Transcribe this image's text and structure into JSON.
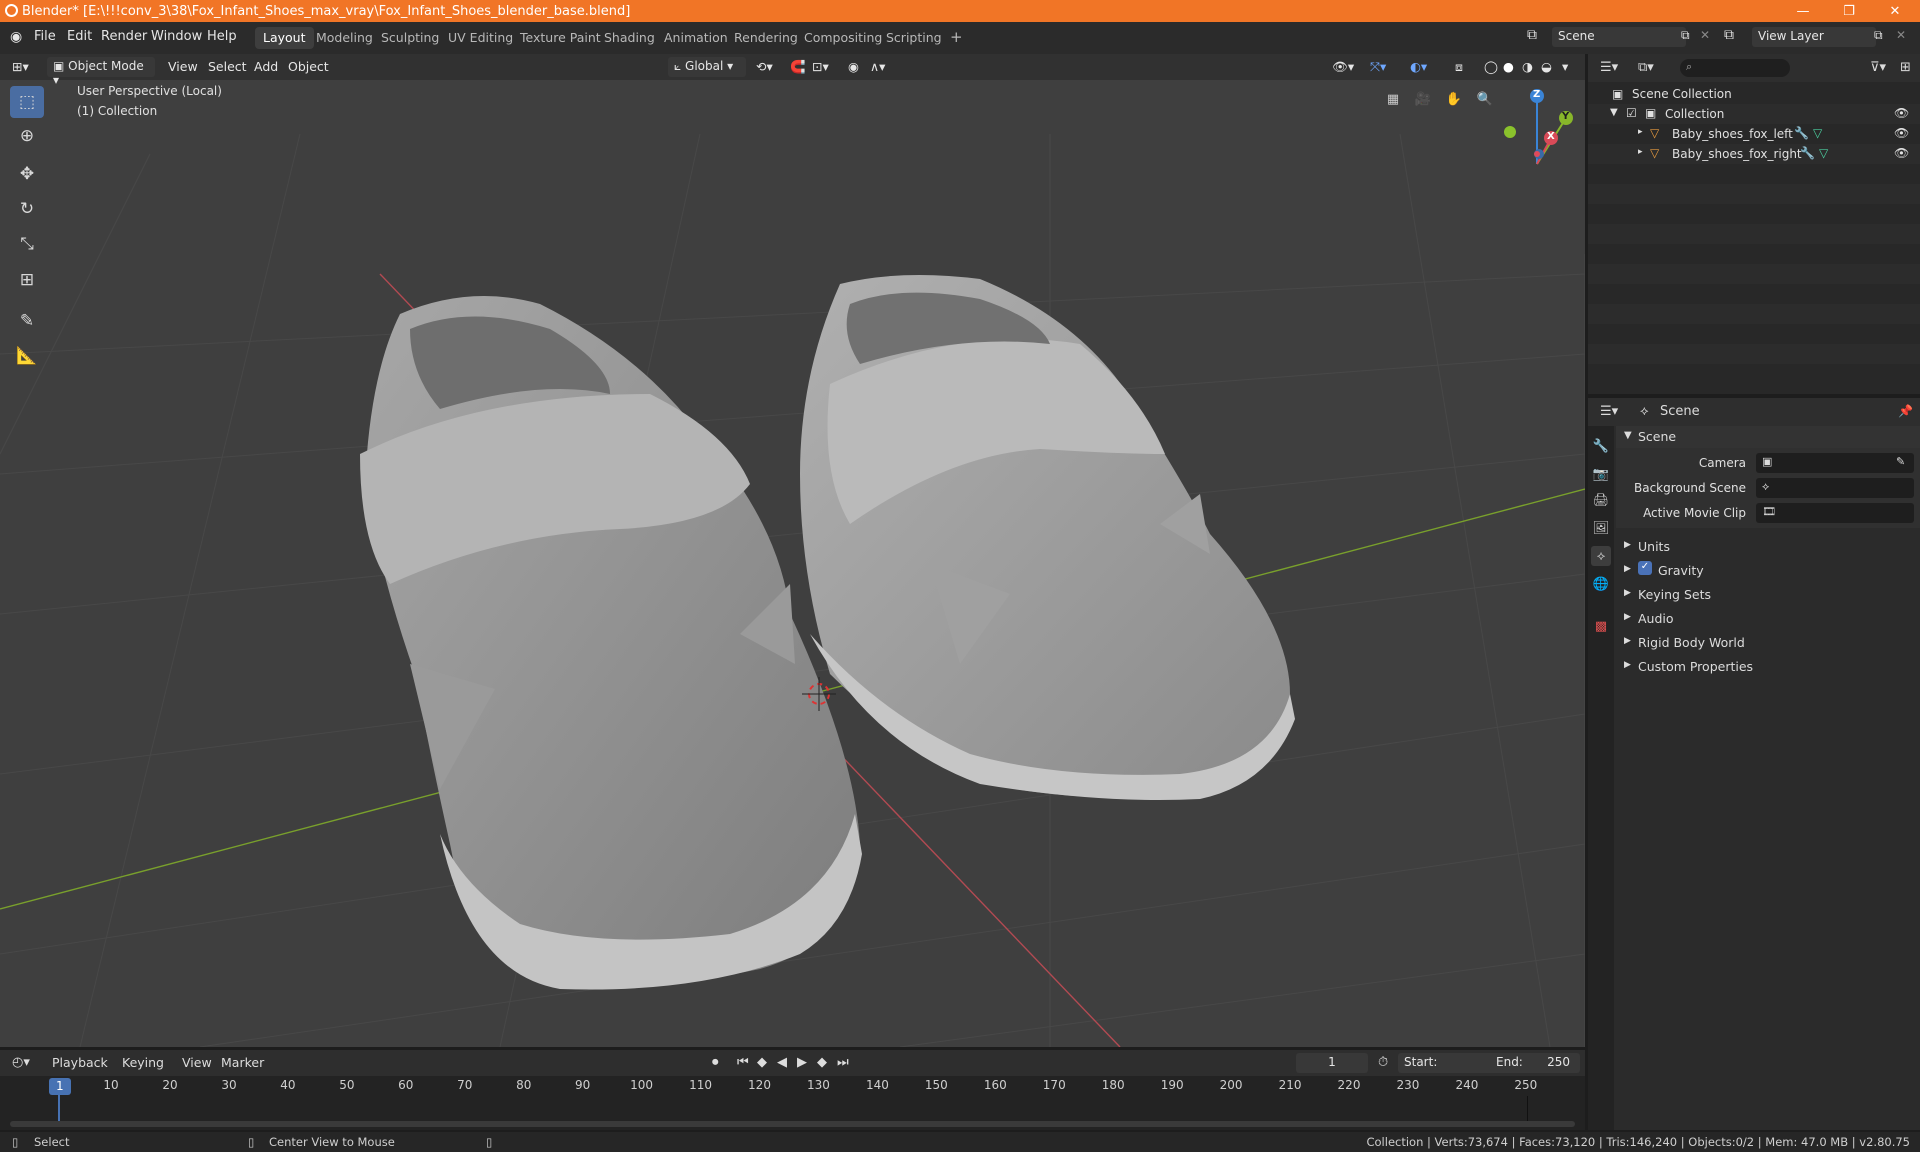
{
  "window": {
    "title": "Blender* [E:\\!!!conv_3\\38\\Fox_Infant_Shoes_max_vray\\Fox_Infant_Shoes_blender_base.blend]",
    "minimize": "—",
    "restore": "❐",
    "close": "✕"
  },
  "menu": {
    "items": [
      "File",
      "Edit",
      "Render",
      "Window",
      "Help"
    ],
    "workspaces": [
      "Layout",
      "Modeling",
      "Sculpting",
      "UV Editing",
      "Texture Paint",
      "Shading",
      "Animation",
      "Rendering",
      "Compositing",
      "Scripting"
    ],
    "add_workspace": "+",
    "scene_label": "Scene",
    "view_layer_label": "View Layer"
  },
  "viewport": {
    "mode": "Object Mode",
    "header_menus": [
      "View",
      "Select",
      "Add",
      "Object"
    ],
    "transform_orientation": "Global",
    "overlay_text_1": "User Perspective (Local)",
    "overlay_text_2": "(1) Collection",
    "gizmo": {
      "x": "X",
      "y": "Y",
      "z": "Z"
    },
    "axis_colors": {
      "x": "#d94a58",
      "y": "#88b62a",
      "z": "#3a84d6"
    }
  },
  "tools": [
    "select-box-tool",
    "cursor-tool",
    "move-tool",
    "rotate-tool",
    "scale-tool",
    "transform-tool",
    "annotate-tool",
    "measure-tool"
  ],
  "outliner": {
    "root": "Scene Collection",
    "collection": "Collection",
    "objects": [
      "Baby_shoes_fox_left",
      "Baby_shoes_fox_right"
    ]
  },
  "properties": {
    "context": "Scene",
    "panel": "Scene",
    "fields": [
      {
        "label": "Camera"
      },
      {
        "label": "Background Scene"
      },
      {
        "label": "Active Movie Clip"
      }
    ],
    "sections": [
      "Units",
      "Gravity",
      "Keying Sets",
      "Audio",
      "Rigid Body World",
      "Custom Properties"
    ],
    "gravity_checked": true
  },
  "timeline": {
    "menus": [
      "Playback",
      "Keying",
      "View",
      "Marker"
    ],
    "current_frame": "1",
    "start_label": "Start:",
    "start_value": "1",
    "end_label": "End:",
    "end_value": "250",
    "ticks": [
      "1",
      "10",
      "20",
      "30",
      "40",
      "50",
      "60",
      "70",
      "80",
      "90",
      "100",
      "110",
      "120",
      "130",
      "140",
      "150",
      "160",
      "170",
      "180",
      "190",
      "200",
      "210",
      "220",
      "230",
      "240",
      "250"
    ]
  },
  "status": {
    "select": "Select",
    "center_view": "Center View to Mouse",
    "stats": "Collection | Verts:73,674 | Faces:73,120 | Tris:146,240 | Objects:0/2 | Mem: 47.0 MB | v2.80.75"
  }
}
